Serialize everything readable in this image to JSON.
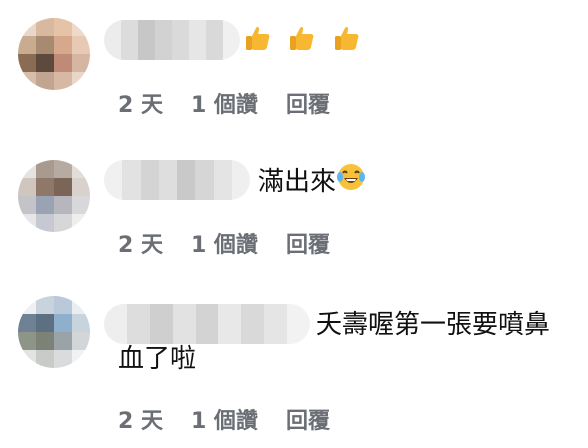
{
  "comments": [
    {
      "text": "",
      "emoji": [
        "thumbs-up",
        "thumbs-up",
        "thumbs-up"
      ],
      "time": "2 天",
      "likes": "1 個讚",
      "reply": "回覆"
    },
    {
      "text": "滿出來",
      "emoji": [
        "laughing-tears"
      ],
      "time": "2 天",
      "likes": "1 個讚",
      "reply": "回覆"
    },
    {
      "text": "夭壽喔第一張要噴鼻",
      "text_line2": "血了啦",
      "time": "2 天",
      "likes": "1 個讚",
      "reply": "回覆"
    }
  ],
  "icons": {
    "thumbs_up": "thumbs-up-icon",
    "laughing": "face-with-tears-of-joy-icon"
  },
  "colors": {
    "text": "#111111",
    "meta": "#6b6f75",
    "emoji_yellow": "#F7B731"
  }
}
